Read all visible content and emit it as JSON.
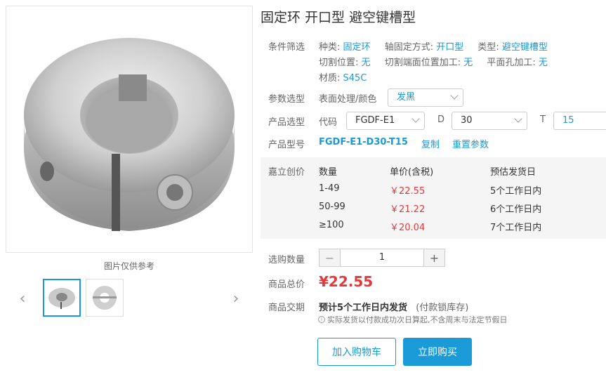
{
  "product": {
    "title": "固定环 开口型 避空键槽型",
    "ref_note": "图片仅供参考"
  },
  "filters": {
    "label": "条件筛选",
    "items_line1": [
      {
        "key": "种类:",
        "value": "固定环"
      },
      {
        "key": "轴固定方式:",
        "value": "开口型"
      },
      {
        "key": "类型:",
        "value": "避空键槽型"
      }
    ],
    "items_line2": [
      {
        "key": "切割位置:",
        "value": "无"
      },
      {
        "key": "切割端面位置加工:",
        "value": "无"
      },
      {
        "key": "平面孔加工:",
        "value": "无"
      }
    ],
    "items_line3": [
      {
        "key": "材质:",
        "value": "S45C"
      }
    ]
  },
  "params": {
    "label": "参数选型",
    "surface_label": "表面处理/颜色",
    "surface_value": "发黑"
  },
  "selection": {
    "label": "产品选型",
    "code_label": "代码",
    "code_value": "FGDF-E1",
    "d_label": "D",
    "d_value": "30",
    "t_label": "T",
    "t_value": "15"
  },
  "model": {
    "label": "产品型号",
    "code": "FGDF-E1-D30-T15",
    "copy": "复制",
    "reset": "重置参数"
  },
  "pricing": {
    "label": "嘉立创价",
    "headers": [
      "数量",
      "单价(含税)",
      "预估发货日"
    ],
    "rows": [
      {
        "qty": "1-49",
        "price": "￥22.55",
        "ship": "5个工作日内"
      },
      {
        "qty": "50-99",
        "price": "￥21.22",
        "ship": "6个工作日内"
      },
      {
        "qty": "≥100",
        "price": "￥20.04",
        "ship": "7个工作日内"
      }
    ]
  },
  "quantity": {
    "label": "选购数量",
    "minus": "−",
    "value": "1",
    "plus": "+"
  },
  "total": {
    "label": "商品总价",
    "value": "¥22.55"
  },
  "delivery": {
    "label": "商品交期",
    "main": "预计5个工作日内发货",
    "sub": "(付款锁库存)",
    "note_icon": "i",
    "note": "实际发货以付款成功次日算起,不含周末与法定节假日"
  },
  "actions": {
    "cart": "加入购物车",
    "buy": "立即购买"
  },
  "colors": {
    "accent": "#1a9ad6",
    "price": "#e4393c"
  }
}
